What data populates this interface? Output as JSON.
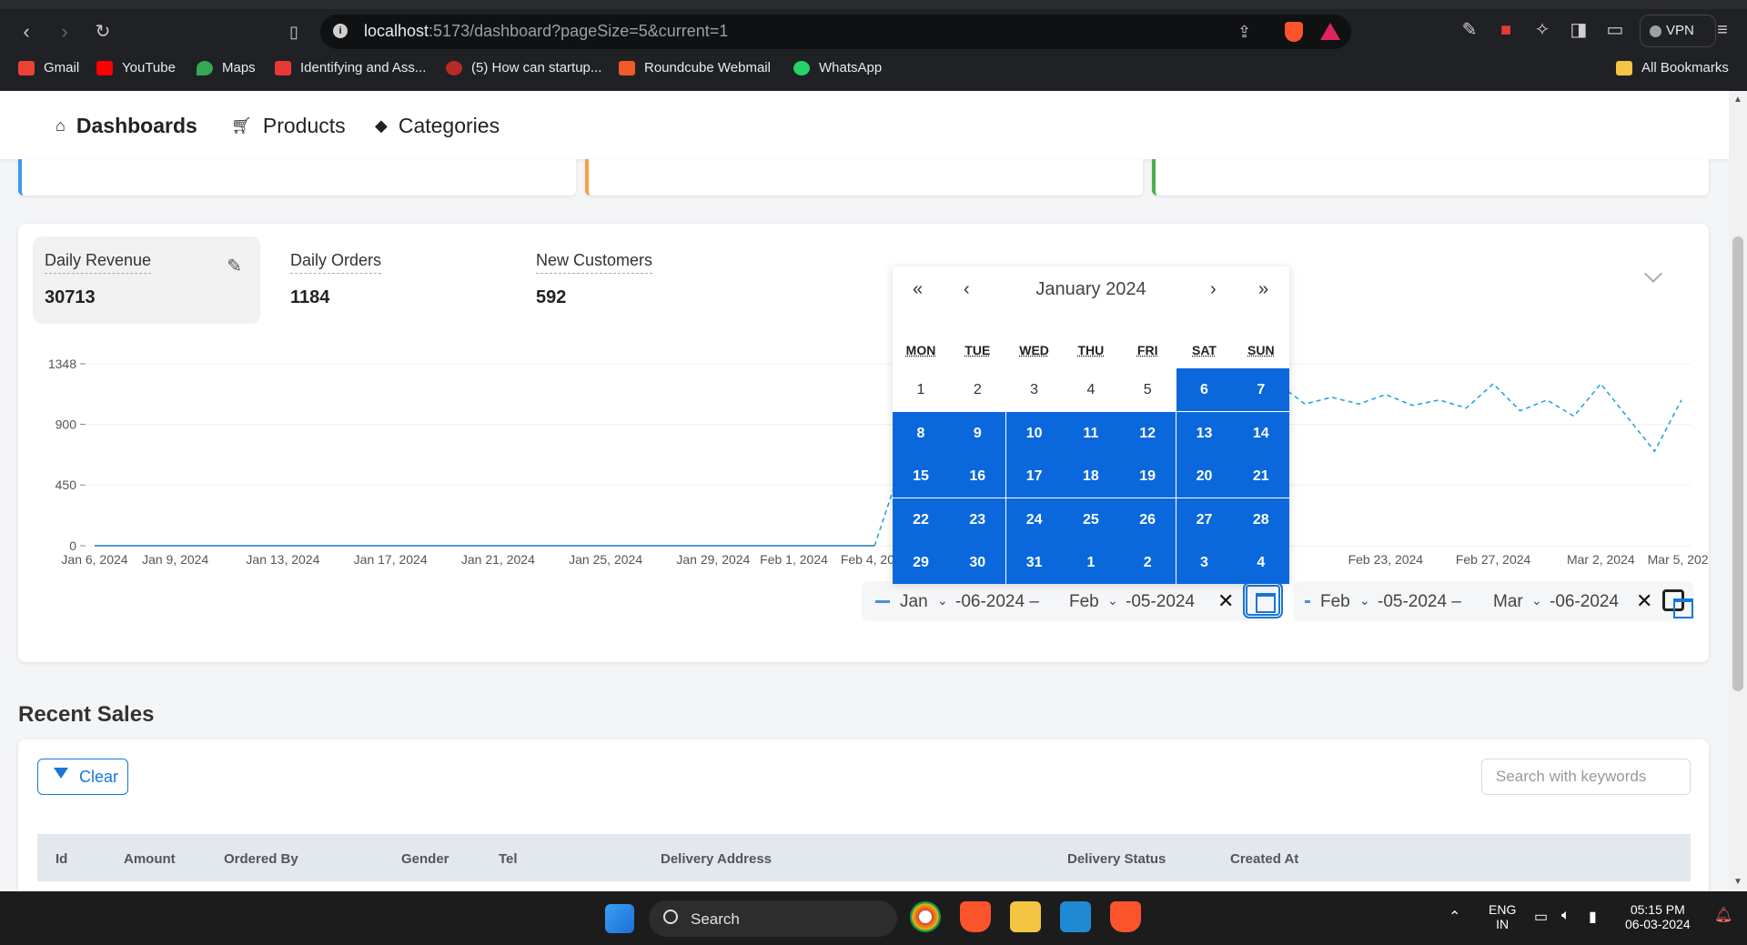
{
  "browser": {
    "url_host": "localhost",
    "url_rest": ":5173/dashboard?pageSize=5&current=1",
    "vpn_label": "VPN",
    "bookmarks": [
      {
        "label": "Gmail",
        "color": "#ea4335"
      },
      {
        "label": "YouTube",
        "color": "#ff0000"
      },
      {
        "label": "Maps",
        "color": "#34a853"
      },
      {
        "label": "Identifying and Ass...",
        "color": "#e53935"
      },
      {
        "label": "(5) How can startup...",
        "color": "#b92b27"
      },
      {
        "label": "Roundcube Webmail",
        "color": "#f05a28"
      },
      {
        "label": "WhatsApp",
        "color": "#25d366"
      }
    ],
    "all_bookmarks": "All Bookmarks"
  },
  "nav": {
    "items": [
      {
        "label": "Dashboards",
        "icon": "home-icon"
      },
      {
        "label": "Products",
        "icon": "cart-icon"
      },
      {
        "label": "Categories",
        "icon": "tag-icon"
      }
    ]
  },
  "stat_cards": {
    "accents": [
      "#3b9bee",
      "#f5a04d",
      "#4cb050"
    ]
  },
  "kpis": [
    {
      "label": "Daily Revenue",
      "value": "30713"
    },
    {
      "label": "Daily Orders",
      "value": "1184"
    },
    {
      "label": "New Customers",
      "value": "592"
    }
  ],
  "chart_data": {
    "type": "line",
    "yticks": [
      "1348",
      "900",
      "450",
      "0"
    ],
    "ylim": [
      0,
      1348
    ],
    "xticks": [
      "Jan 6, 2024",
      "Jan 9, 2024",
      "Jan 13, 2024",
      "Jan 17, 2024",
      "Jan 21, 2024",
      "Jan 25, 2024",
      "Jan 29, 2024",
      "Feb 1, 2024",
      "Feb 4, 2024",
      "Feb 23, 2024",
      "Feb 27, 2024",
      "Mar 2, 2024",
      "Mar 5, 2024"
    ],
    "series": [
      {
        "color": "#1f77b4",
        "x": [
          "Jan 6, 2024",
          "Jan 9, 2024",
          "Jan 13, 2024",
          "Jan 17, 2024",
          "Jan 21, 2024",
          "Jan 25, 2024",
          "Jan 29, 2024",
          "Feb 1, 2024",
          "Feb 4, 2024"
        ],
        "y": [
          0,
          0,
          0,
          0,
          0,
          0,
          0,
          0,
          0
        ]
      },
      {
        "color": "#2aa4dc",
        "dashed": true,
        "x": [
          "Feb 4, 2024",
          "Feb 5, 2024",
          "Feb 19, 2024",
          "Feb 20, 2024",
          "Feb 21, 2024",
          "Feb 22, 2024",
          "Feb 23, 2024",
          "Feb 24, 2024",
          "Feb 25, 2024",
          "Feb 26, 2024",
          "Feb 27, 2024",
          "Feb 28, 2024",
          "Feb 29, 2024",
          "Mar 1, 2024",
          "Mar 2, 2024",
          "Mar 3, 2024",
          "Mar 4, 2024",
          "Mar 5, 2024"
        ],
        "y": [
          0,
          600,
          1200,
          1050,
          1100,
          1050,
          1120,
          1040,
          1080,
          1020,
          1200,
          1000,
          1080,
          960,
          1200,
          950,
          700,
          1080
        ]
      }
    ]
  },
  "range_left": {
    "m1": "Jan",
    "d1": "-06-2024 –",
    "m2": "Feb",
    "d2": "-05-2024"
  },
  "range_right": {
    "m1": "Feb",
    "d1": "-05-2024 –",
    "m2": "Mar",
    "d2": "-06-2024"
  },
  "calendar": {
    "title": "January 2024",
    "nav": [
      "«",
      "‹",
      "›",
      "»"
    ],
    "weekdays": [
      "MON",
      "TUE",
      "WED",
      "THU",
      "FRI",
      "SAT",
      "SUN"
    ],
    "days": [
      "1",
      "2",
      "3",
      "4",
      "5",
      "6",
      "7",
      "8",
      "9",
      "10",
      "11",
      "12",
      "13",
      "14",
      "15",
      "16",
      "17",
      "18",
      "19",
      "20",
      "21",
      "22",
      "23",
      "24",
      "25",
      "26",
      "27",
      "28",
      "29",
      "30",
      "31",
      "1",
      "2",
      "3",
      "4"
    ]
  },
  "sales": {
    "title": "Recent Sales",
    "clear_label": "Clear",
    "search_placeholder": "Search with keywords",
    "columns": [
      "Id",
      "Amount",
      "Ordered By",
      "Gender",
      "Tel",
      "Delivery Address",
      "Delivery Status",
      "Created At"
    ]
  },
  "taskbar": {
    "search_label": "Search",
    "lang": "ENG",
    "region": "IN",
    "time": "05:15 PM",
    "date": "06-03-2024"
  }
}
